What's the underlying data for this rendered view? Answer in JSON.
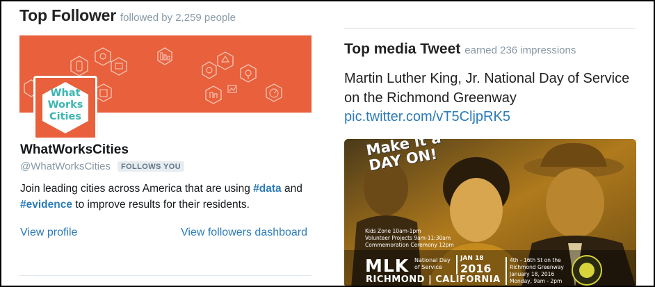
{
  "top_follower": {
    "title": "Top Follower",
    "subtitle": "followed by 2,259 people",
    "profile": {
      "name": "WhatWorksCities",
      "handle": "@WhatWorksCities",
      "follows_badge": "FOLLOWS YOU",
      "bio_part1": "Join leading cities across America that are using ",
      "bio_hashtag1": "#data",
      "bio_part2": " and ",
      "bio_hashtag2": "#evidence",
      "bio_part3": " to improve results for their residents.",
      "logo_line1": "What",
      "logo_line2": "Works",
      "logo_line3": "Cities"
    },
    "view_profile_label": "View profile",
    "view_dashboard_label": "View followers dashboard"
  },
  "top_media_tweet": {
    "title": "Top media Tweet",
    "subtitle": "earned 236 impressions",
    "text": "Martin Luther King, Jr. National Day of Service on the Richmond Greenway",
    "link": "pic.twitter.com/vT5CljpRK5",
    "poster": {
      "headline_line1": "Make it a",
      "headline_line2": "DAY ON!",
      "schedule_line1": "Kids Zone 10am-1pm",
      "schedule_line2": "Volunteer Projects 9am-11:30am",
      "schedule_line3": "Commemoration Ceremony 12pm",
      "mlk": "MLK",
      "nds_line1": "National Day",
      "nds_line2": "of Service",
      "date": "JAN 18",
      "year": "2016",
      "location_line1": "4th - 16th St on the",
      "location_line2": "Richmond Greenway",
      "location_line3": "January 18, 2016",
      "location_line4": "Monday, 9am - 2pm",
      "city": "RICHMOND | CALIFORNIA"
    }
  },
  "colors": {
    "banner": "#e8603c",
    "link_blue": "#2b7bb9",
    "muted_gray": "#8899a6",
    "logo_teal": "#3bb7b1",
    "poster_gold": "#c58a1e"
  },
  "icons": [
    "civic-hexagon-icon"
  ]
}
